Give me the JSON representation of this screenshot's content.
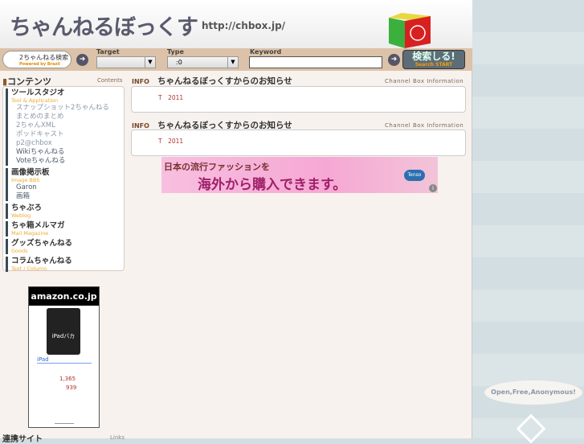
{
  "header": {
    "logo": "ちゃんねるぼっくす",
    "url": "http://chbox.jp/"
  },
  "search": {
    "brand": "2ちゃんねる検索",
    "brand_sub": "Powered by Brazil",
    "target_label": "Target",
    "target_value": "",
    "type_label": "Type",
    "type_value": ":0",
    "keyword_label": "Keyword",
    "keyword_value": "",
    "start_label": "検索しる!",
    "start_sub": "Search START"
  },
  "sidebar": {
    "title": "コンテンツ",
    "title_en": "Contents",
    "groups": [
      {
        "title": "ツールスタジオ",
        "sub": "Tool & Application",
        "items": [
          "スナップショット2ちゃんねる",
          "まとめのまとめ",
          "2ちゃんXML",
          "ポッドキャスト",
          "p2@chbox",
          "Wikiちゃんねる",
          "Voteちゃんねる"
        ]
      },
      {
        "title": "画像掲示板",
        "sub": "Image BBS",
        "items": [
          "Garon",
          "画箱"
        ]
      },
      {
        "title": "ちゃぶろ",
        "sub": "Weblog",
        "items": []
      },
      {
        "title": "ちゃ箱メルマガ",
        "sub": "Mail Magazine",
        "items": []
      },
      {
        "title": "グッズちゃんねる",
        "sub": "Goods",
        "items": []
      },
      {
        "title": "コラムちゃんねる",
        "sub": "Text / Column",
        "items": []
      }
    ]
  },
  "info": [
    {
      "icon": "INFO",
      "title": "ちゃんねるぼっくすからのお知らせ",
      "sub": "Channel Box Information",
      "text": "T　2011"
    },
    {
      "icon": "INFO",
      "title": "ちゃんねるぼっくすからのお知らせ",
      "sub": "Channel Box Information",
      "text": "T　2011"
    }
  ],
  "banner": {
    "line1": "日本の流行ファッションを",
    "line2": "海外から購入できます。",
    "brand": "Tenso"
  },
  "amazon": {
    "logo": "amazon.co.jp",
    "product_image_text": "iPadバカ",
    "link": "iPad",
    "price1": "1,365",
    "price2": "939"
  },
  "links": {
    "title": "連携サイト",
    "sub": "Links"
  },
  "side_right": {
    "slogan": "Open,Free,Anonymous!"
  }
}
